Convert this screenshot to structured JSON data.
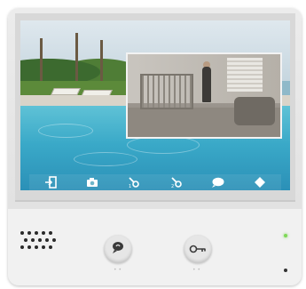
{
  "device": {
    "status_led_color": "#7ed957",
    "sensor_dot_color": "#333333"
  },
  "screen": {
    "main_feed": "poolside-camera",
    "pip_feed": "nursery-camera",
    "toolbar": [
      {
        "name": "exit-icon"
      },
      {
        "name": "camera-snapshot-icon"
      },
      {
        "name": "door-unlock-1-icon"
      },
      {
        "name": "door-unlock-2-icon"
      },
      {
        "name": "intercom-chat-icon"
      },
      {
        "name": "menu-grid-icon"
      }
    ]
  },
  "panel": {
    "talk_button": {
      "icon": "talk-handset-icon"
    },
    "unlock_button": {
      "icon": "key-icon"
    }
  }
}
